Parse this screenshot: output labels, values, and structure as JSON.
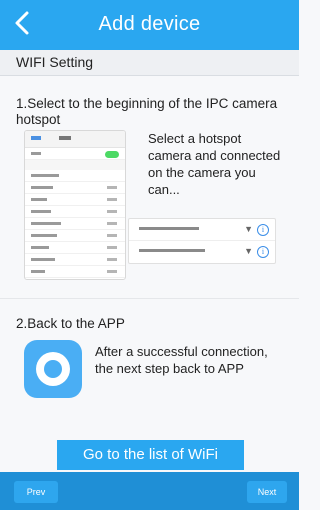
{
  "header": {
    "title": "Add device",
    "back_icon": "chevron-left-icon",
    "color": "#2aa7f0"
  },
  "section": {
    "title": "WIFI Setting"
  },
  "step1": {
    "title": "1.Select to the beginning of the IPC camera hotspot",
    "instruction": "Select a hotspot camera and connected on the camera you can..."
  },
  "step2": {
    "title": "2.Back to the APP",
    "instruction": "After a successful connection, the next step back to APP"
  },
  "actions": {
    "wifi_button_label": "Go to the list of WiFi"
  },
  "footer": {
    "prev_label": "Prev",
    "next_label": "Next",
    "color": "#1f8fd6"
  }
}
